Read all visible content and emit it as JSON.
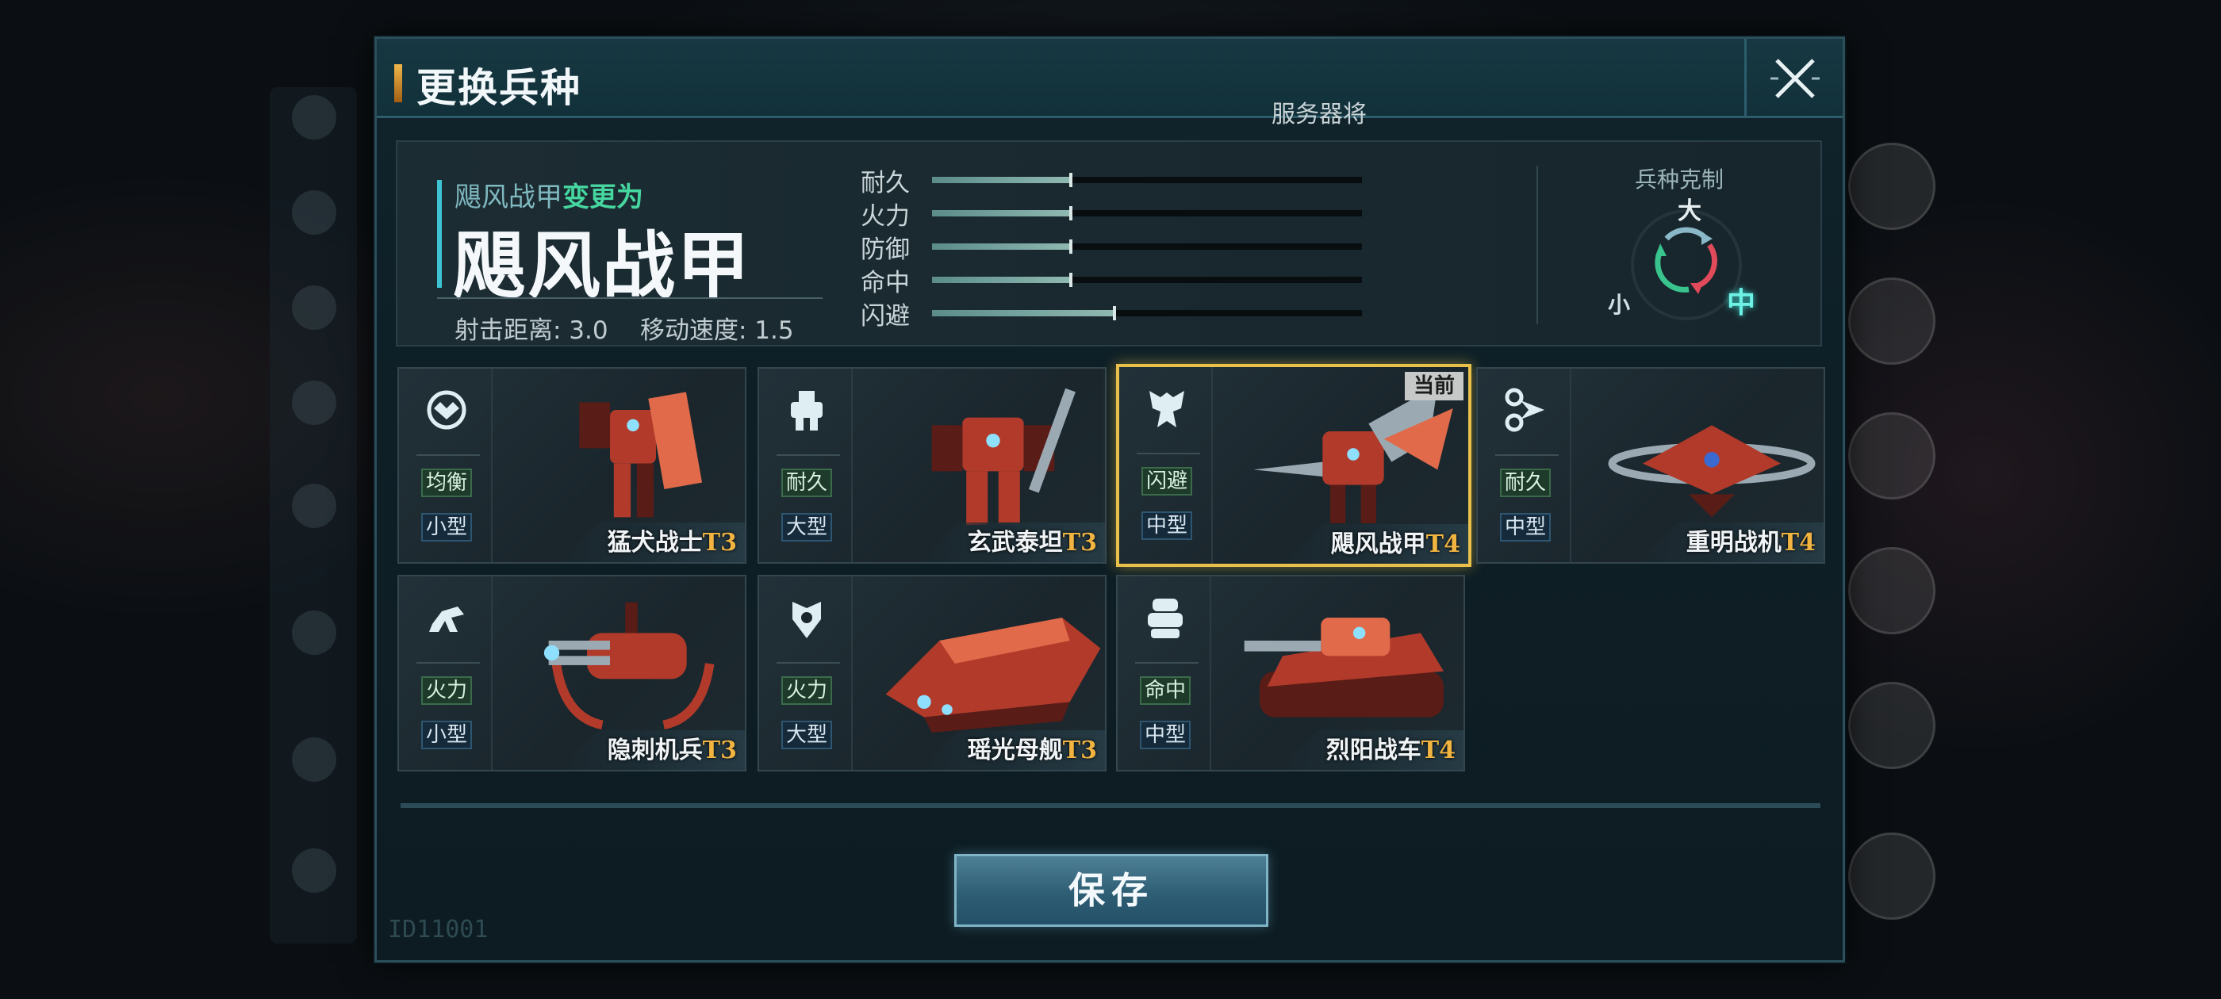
{
  "dialog": {
    "title": "更换兵种",
    "close_symbol": "✕",
    "server_note": "服务器将"
  },
  "info": {
    "from_name": "飓风战甲",
    "change_to_text": "变更为",
    "target_name": "飓风战甲",
    "range_label": "射击距离",
    "range_value": "3.0",
    "speed_label": "移动速度",
    "speed_value": "1.5",
    "range_text": "射击距离: 3.0",
    "speed_text": "移动速度: 1.5",
    "stats": [
      {
        "label": "耐久",
        "value": 0.32
      },
      {
        "label": "火力",
        "value": 0.32
      },
      {
        "label": "防御",
        "value": 0.32
      },
      {
        "label": "命中",
        "value": 0.32
      },
      {
        "label": "闪避",
        "value": 0.42
      }
    ]
  },
  "counter": {
    "title": "兵种克制",
    "large": "大",
    "medium": "中",
    "small": "小"
  },
  "units": [
    {
      "name": "猛犬战士",
      "tier": "T3",
      "role": "均衡",
      "size": "小型",
      "icon": "balanced-mech-icon",
      "selected": false
    },
    {
      "name": "玄武泰坦",
      "tier": "T3",
      "role": "耐久",
      "size": "大型",
      "icon": "titan-icon",
      "selected": false
    },
    {
      "name": "飓风战甲",
      "tier": "T4",
      "role": "闪避",
      "size": "中型",
      "icon": "armor-icon",
      "selected": true,
      "tag": "当前"
    },
    {
      "name": "重明战机",
      "tier": "T4",
      "role": "耐久",
      "size": "中型",
      "icon": "aircraft-icon",
      "selected": false
    },
    {
      "name": "隐刺机兵",
      "tier": "T3",
      "role": "火力",
      "size": "小型",
      "icon": "spider-mech-icon",
      "selected": false
    },
    {
      "name": "瑶光母舰",
      "tier": "T3",
      "role": "火力",
      "size": "大型",
      "icon": "mothership-icon",
      "selected": false
    },
    {
      "name": "烈阳战车",
      "tier": "T4",
      "role": "命中",
      "size": "中型",
      "icon": "tank-icon",
      "selected": false
    }
  ],
  "save_label": "保存",
  "footer_id": "ID11001",
  "colors": {
    "accent_teal": "#3ec3d2",
    "accent_green": "#46d7a0",
    "tier_gold": "#f2b441",
    "selected_border": "#e8c04a",
    "counter_red": "#e04a5a",
    "counter_green": "#39c48e",
    "counter_blue": "#8ab8c8"
  }
}
